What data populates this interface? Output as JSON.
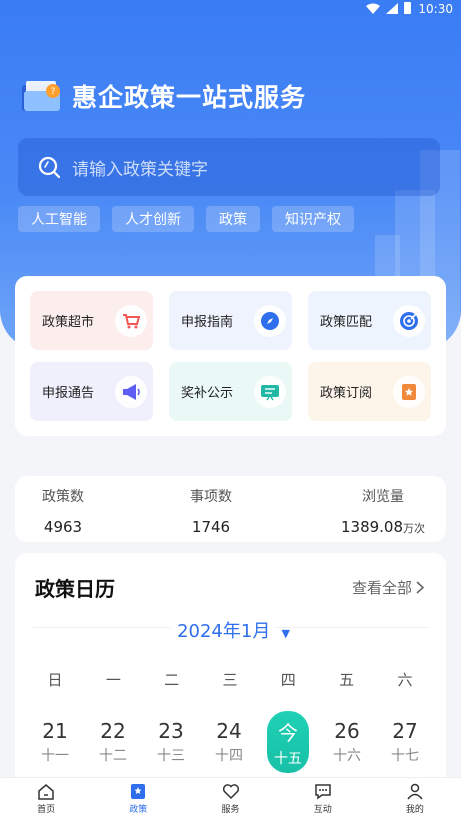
{
  "status_bar": {
    "time": "10:30"
  },
  "header": {
    "title": "惠企政策一站式服务",
    "icon": "folder-badge-icon"
  },
  "search": {
    "placeholder": "请输入政策关键字",
    "icon": "search-icon"
  },
  "tags": [
    {
      "label": "人工智能"
    },
    {
      "label": "人才创新"
    },
    {
      "label": "政策"
    },
    {
      "label": "知识产权"
    }
  ],
  "services": [
    {
      "label": "政策超市",
      "icon": "cart-icon",
      "bg": "#fdeeee",
      "accent": "#f05656"
    },
    {
      "label": "申报指南",
      "icon": "compass-icon",
      "bg": "#eef3fd",
      "accent": "#2f6fed"
    },
    {
      "label": "政策匹配",
      "icon": "target-icon",
      "bg": "#eef4fd",
      "accent": "#2f6fed"
    },
    {
      "label": "申报通告",
      "icon": "megaphone-icon",
      "bg": "#f0f0fd",
      "accent": "#5b5ef0"
    },
    {
      "label": "奖补公示",
      "icon": "board-icon",
      "bg": "#eaf8f6",
      "accent": "#22b8a6"
    },
    {
      "label": "政策订阅",
      "icon": "bookmark-icon",
      "bg": "#fdf4ea",
      "accent": "#f08a3a"
    }
  ],
  "stats": [
    {
      "label": "政策数",
      "value": "4963",
      "unit": ""
    },
    {
      "label": "事项数",
      "value": "1746",
      "unit": ""
    },
    {
      "label": "浏览量",
      "value": "1389.08",
      "unit": "万次"
    }
  ],
  "calendar": {
    "title": "政策日历",
    "more": "查看全部",
    "month": "2024年1月",
    "weekdays": [
      "日",
      "一",
      "二",
      "三",
      "四",
      "五",
      "六"
    ],
    "days": [
      {
        "num": "21",
        "lunar": "十一"
      },
      {
        "num": "22",
        "lunar": "十二"
      },
      {
        "num": "23",
        "lunar": "十三"
      },
      {
        "num": "24",
        "lunar": "十四"
      },
      {
        "num": "今",
        "lunar": "十五",
        "today": true
      },
      {
        "num": "26",
        "lunar": "十六"
      },
      {
        "num": "27",
        "lunar": "十七"
      }
    ]
  },
  "tabbar": [
    {
      "label": "首页",
      "icon": "home-icon"
    },
    {
      "label": "政策",
      "icon": "policy-icon",
      "active": true
    },
    {
      "label": "服务",
      "icon": "heart-icon"
    },
    {
      "label": "互动",
      "icon": "chat-icon"
    },
    {
      "label": "我的",
      "icon": "user-icon"
    }
  ],
  "colors": {
    "primary": "#2f6fed",
    "today": "#1fc8ad",
    "hero": "#3a7cf4"
  }
}
